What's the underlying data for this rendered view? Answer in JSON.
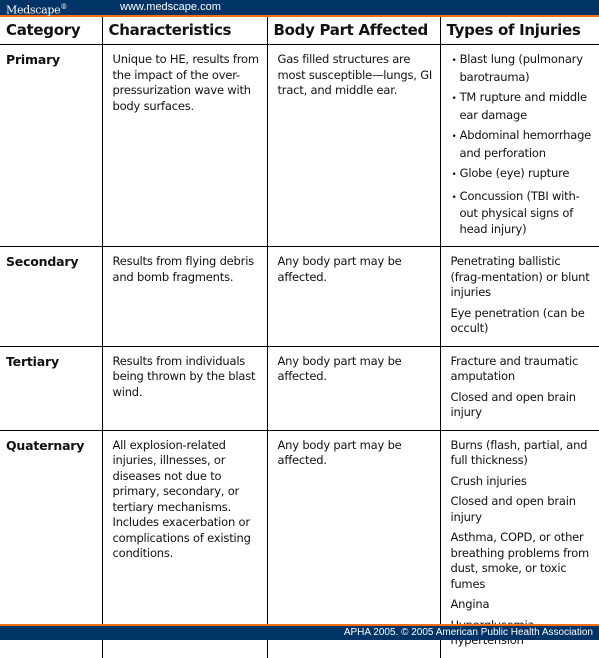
{
  "header": {
    "brand": "Medscape",
    "brand_mark": "®",
    "url": "www.medscape.com"
  },
  "table": {
    "columns": [
      "Category",
      "Characteristics",
      "Body Part Affected",
      "Types of Injuries"
    ],
    "rows": [
      {
        "category": "Primary",
        "characteristics": "Unique to HE, results from the impact of the over-pressurization wave with body surfaces.",
        "body_part": "Gas filled structures are most susceptible—lungs, GI tract, and middle ear.",
        "bulleted": true,
        "injuries": [
          "Blast lung (pulmonary barotrauma)",
          "TM rupture and middle ear damage",
          "Abdominal hemorrhage and perforation",
          "Globe (eye) rupture",
          "Concussion (TBI with-out physical signs of head injury)"
        ]
      },
      {
        "category": "Secondary",
        "characteristics": "Results from flying debris and bomb fragments.",
        "body_part": "Any body part may be affected.",
        "bulleted": false,
        "injuries": [
          "Penetrating ballistic (frag-mentation) or blunt injuries",
          "Eye penetration (can be occult)"
        ]
      },
      {
        "category": "Tertiary",
        "characteristics": "Results from individuals being thrown by the blast wind.",
        "body_part": "Any body part may be affected.",
        "bulleted": false,
        "injuries": [
          "Fracture and traumatic amputation",
          "Closed and open brain injury"
        ]
      },
      {
        "category": "Quaternary",
        "characteristics": "All explosion-related injuries, illnesses, or diseases not due to primary, secondary, or tertiary mechanisms. Includes exacerbation or complications of existing conditions.",
        "body_part": "Any body part may be affected.",
        "bulleted": false,
        "injuries": [
          "Burns (flash, partial, and full thickness)",
          "Crush injuries",
          "Closed and open brain injury",
          "Asthma, COPD, or other breathing problems from dust, smoke, or toxic fumes",
          "Angina",
          "Hyperglycemia, hypertension"
        ]
      }
    ]
  },
  "footer": {
    "credit": "APHA 2005. © 2005 American Public Health Association"
  },
  "colors": {
    "bar_blue": "#003366",
    "bar_orange": "#f26f13"
  }
}
